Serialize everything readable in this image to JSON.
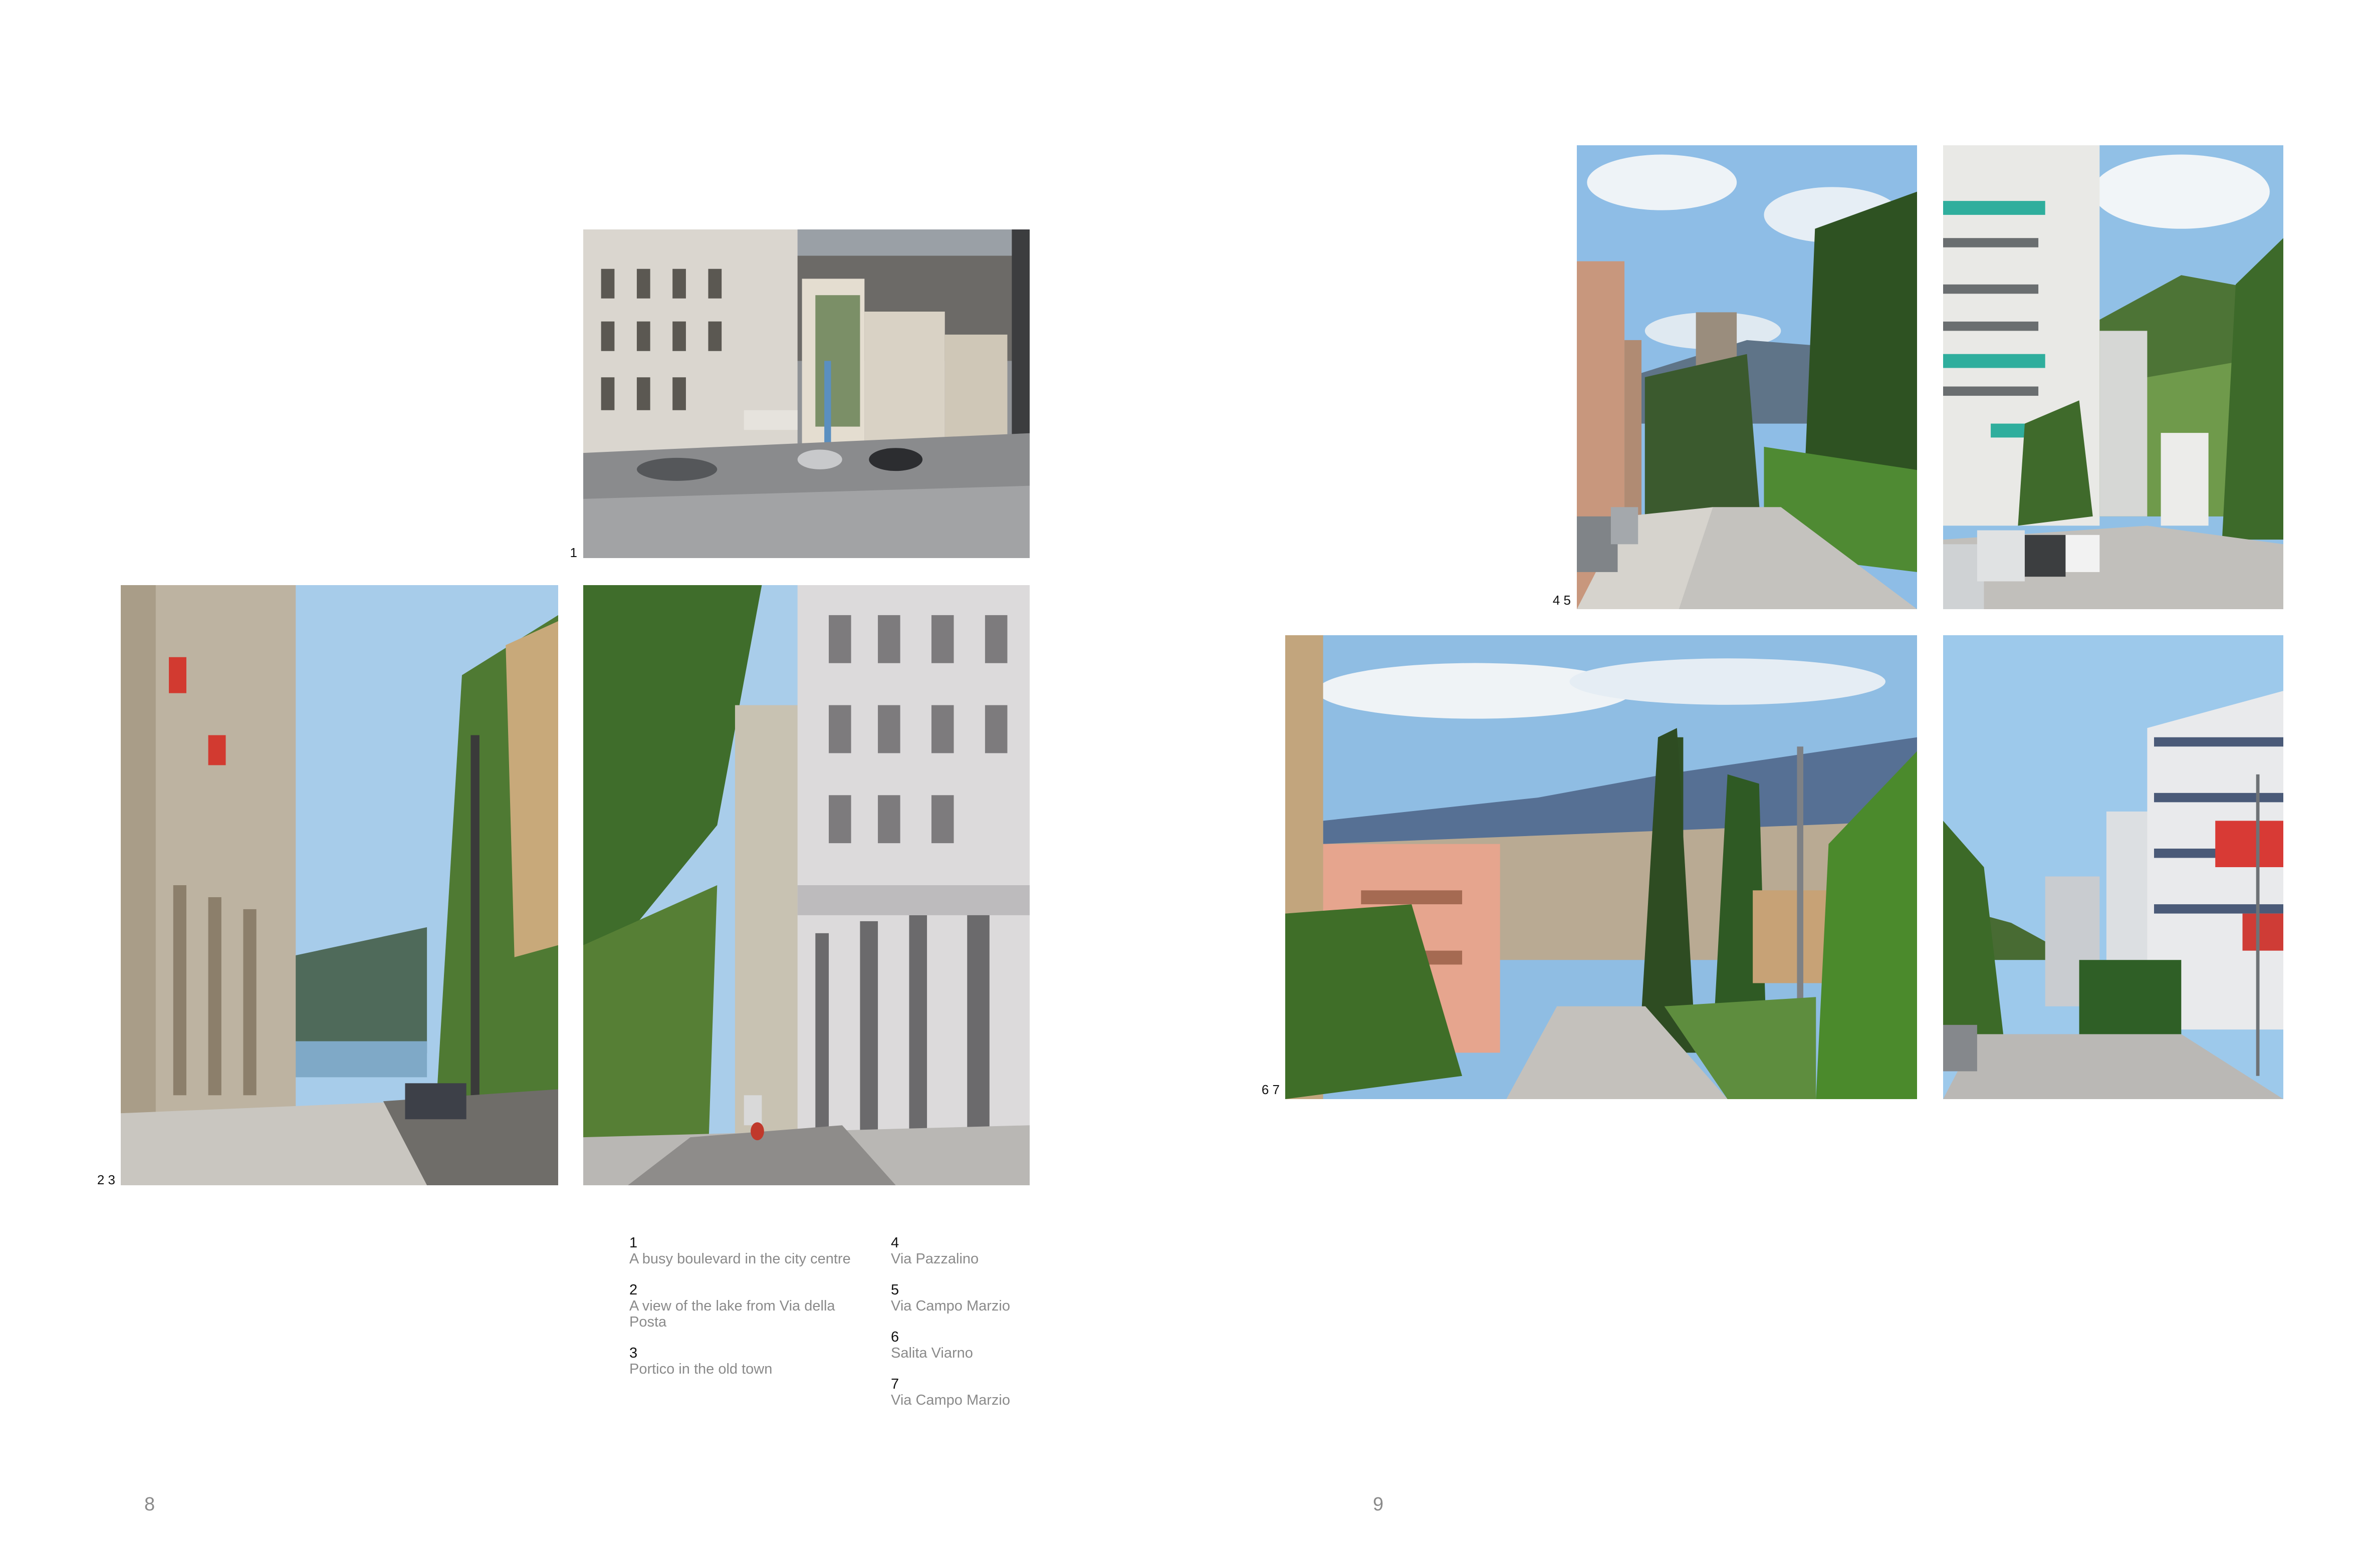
{
  "spread": {
    "left_page_number": "8",
    "right_page_number": "9"
  },
  "figure_labels": {
    "fig1": "1",
    "fig23": "2 3",
    "fig45": "4 5",
    "fig67": "6 7"
  },
  "captions": {
    "column1": [
      {
        "num": "1",
        "text": "A busy boulevard in the city centre"
      },
      {
        "num": "2",
        "text": "A view of the lake from Via della Posta"
      },
      {
        "num": "3",
        "text": "Portico in the old town"
      }
    ],
    "column2": [
      {
        "num": "4",
        "text": "Via Pazzalino"
      },
      {
        "num": "5",
        "text": "Via Campo Marzio"
      },
      {
        "num": "6",
        "text": "Salita Viarno"
      },
      {
        "num": "7",
        "text": "Via Campo Marzio"
      }
    ]
  },
  "colors": {
    "sky": "#a9cdea",
    "caption_grey": "#8a8a8a",
    "foliage": "#3e6b2c",
    "road": "#c9c6c0"
  }
}
